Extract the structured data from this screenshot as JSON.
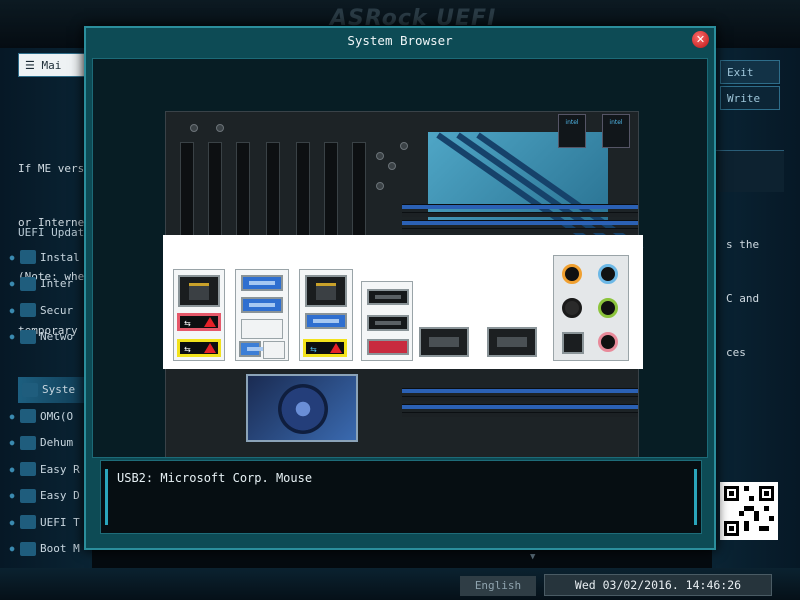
{
  "background": {
    "brand": "ASRock UEFI",
    "mode_button": "☰ Mai",
    "exit_button": "Exit",
    "tool_button": "Write",
    "left_description": [
      "If ME vers",
      "or Interne",
      "(Note: whe",
      "temporary"
    ],
    "right_description": [
      "s the",
      "C and",
      "ces"
    ],
    "uefi_update_label": "UEFI Updat",
    "nav_items": [
      {
        "label": "Instal"
      },
      {
        "label": "Inter"
      },
      {
        "label": "Secur"
      },
      {
        "label": "Netwo"
      },
      {
        "label": "Syste"
      },
      {
        "label": "OMG(O"
      },
      {
        "label": "Dehum"
      },
      {
        "label": "Easy R"
      },
      {
        "label": "Easy D"
      },
      {
        "label": "UEFI T"
      },
      {
        "label": "Boot M"
      }
    ],
    "active_nav_index": 4,
    "language_button": "English",
    "datetime": "Wed 03/02/2016. 14:46:26"
  },
  "dialog": {
    "title": "System Browser",
    "close_icon": "close-icon",
    "selected_device_info": "USB2: Microsoft Corp. Mouse"
  },
  "colors": {
    "dialog_bg": "#0d4b55",
    "usb_highlight_red": "#e5586a",
    "usb_highlight_yellow": "#f2e21c",
    "usb3_blue": "#2f6fd0",
    "esata_red": "#c82a3e"
  }
}
